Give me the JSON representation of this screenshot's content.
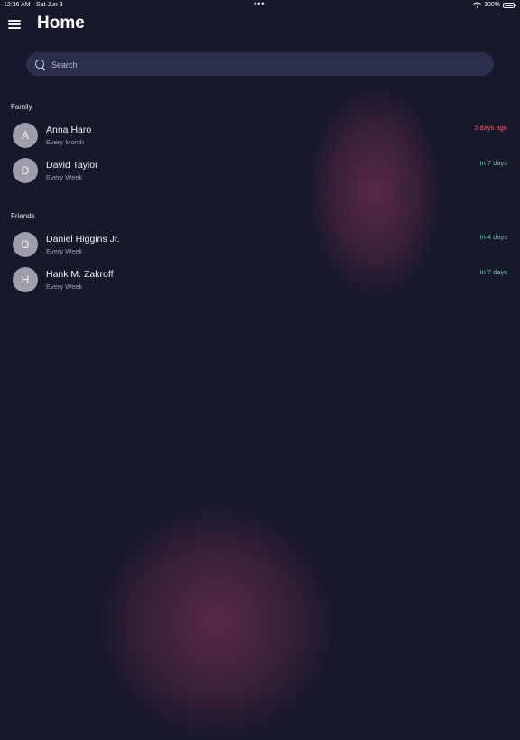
{
  "status_bar": {
    "time": "12:36 AM",
    "date": "Sat Jun 3",
    "dots": "•••",
    "battery": "100%"
  },
  "header": {
    "title": "Home",
    "menu_icon": "hamburger-menu-icon"
  },
  "search": {
    "placeholder": "Search",
    "value": "",
    "icon": "search-icon"
  },
  "sections": [
    {
      "title": "Family",
      "contacts": [
        {
          "initial": "A",
          "name": "Anna Haro",
          "frequency": "Every Month",
          "due": "2 days ago",
          "due_status": "overdue"
        },
        {
          "initial": "D",
          "name": "David Taylor",
          "frequency": "Every Week",
          "due": "In 7 days",
          "due_status": "upcoming"
        }
      ]
    },
    {
      "title": "Friends",
      "contacts": [
        {
          "initial": "D",
          "name": "Daniel Higgins Jr.",
          "frequency": "Every Week",
          "due": "In 4 days",
          "due_status": "upcoming"
        },
        {
          "initial": "H",
          "name": "Hank M. Zakroff",
          "frequency": "Every Week",
          "due": "In 7 days",
          "due_status": "upcoming"
        }
      ]
    }
  ],
  "colors": {
    "background": "#17182a",
    "search_background": "#2c2f4c",
    "avatar": "#9d9eaa",
    "overdue": "#e8626a",
    "upcoming": "#66c69f"
  }
}
